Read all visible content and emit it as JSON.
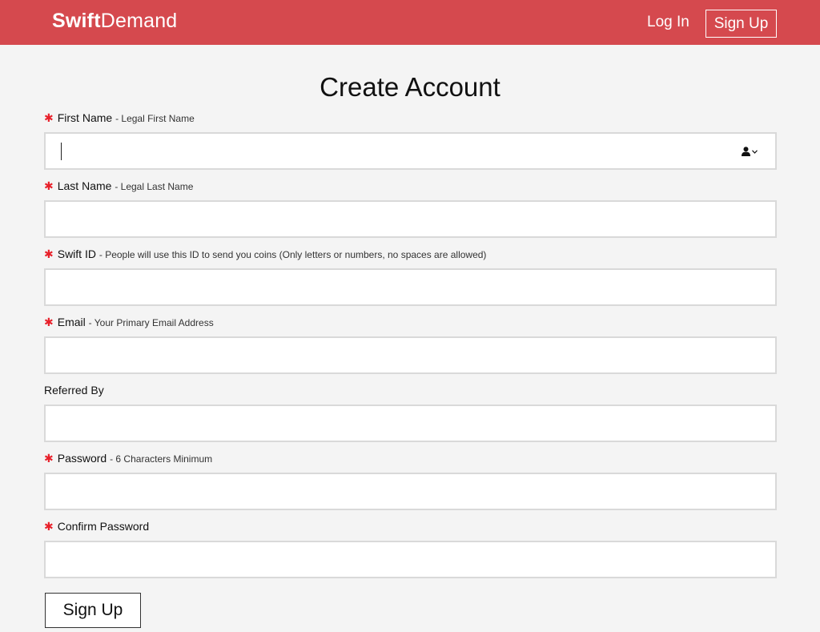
{
  "header": {
    "brand_bold": "Swift",
    "brand_light": "Demand",
    "login_label": "Log In",
    "signup_label": "Sign Up",
    "background_color": "#d5494e"
  },
  "form": {
    "title": "Create Account",
    "required_marker": "✱",
    "fields": [
      {
        "label": "First Name",
        "hint": "- Legal First Name",
        "required": true,
        "value": ""
      },
      {
        "label": "Last Name",
        "hint": "- Legal Last Name",
        "required": true,
        "value": ""
      },
      {
        "label": "Swift ID",
        "hint": "- People will use this ID to send you coins (Only letters or numbers, no spaces are allowed)",
        "required": true,
        "value": ""
      },
      {
        "label": "Email",
        "hint": "- Your Primary Email Address",
        "required": true,
        "value": ""
      },
      {
        "label": "Referred By",
        "hint": "",
        "required": false,
        "value": ""
      },
      {
        "label": "Password",
        "hint": "- 6 Characters Minimum",
        "required": true,
        "value": ""
      },
      {
        "label": "Confirm Password",
        "hint": "",
        "required": true,
        "value": ""
      }
    ],
    "autofill_icon": "person-chevron-icon",
    "submit_label": "Sign Up",
    "required_color": "#e8202a"
  }
}
